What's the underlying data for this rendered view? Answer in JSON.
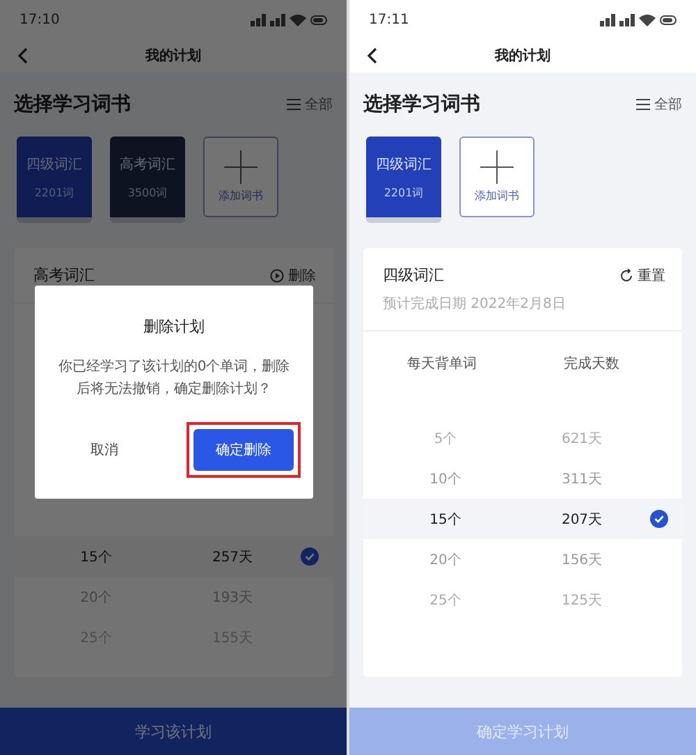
{
  "screens": [
    {
      "status_time": "17:10",
      "title": "我的计划",
      "section_title": "选择学习词书",
      "filter_label": "全部",
      "books": [
        {
          "name": "四级词汇",
          "count": "2201词"
        },
        {
          "name": "高考词汇",
          "count": "3500词"
        }
      ],
      "add_book_label": "添加词书",
      "plan": {
        "name": "高考词汇",
        "action": {
          "kind": "delete",
          "label": "删除"
        },
        "rows": [
          {
            "per_day": "15个",
            "days": "257天",
            "selected": true
          },
          {
            "per_day": "20个",
            "days": "193天",
            "selected": false
          },
          {
            "per_day": "25个",
            "days": "155天",
            "selected": false
          }
        ]
      },
      "bottom_button": {
        "label": "学习该计划",
        "disabled": false
      },
      "dialog": {
        "title": "删除计划",
        "message": "你已经学习了该计划的0个单词，删除后将无法撤销，确定删除计划？",
        "buttons": [
          {
            "label": "取消",
            "kind": "cancel",
            "highlighted": false
          },
          {
            "label": "确定删除",
            "kind": "confirm",
            "highlighted": true
          }
        ]
      }
    },
    {
      "status_time": "17:11",
      "title": "我的计划",
      "section_title": "选择学习词书",
      "filter_label": "全部",
      "books": [
        {
          "name": "四级词汇",
          "count": "2201词"
        }
      ],
      "add_book_label": "添加词书",
      "plan": {
        "name": "四级词汇",
        "action": {
          "kind": "reset",
          "label": "重置"
        },
        "subtitle": "预计完成日期 2022年2月8日",
        "columns": [
          "每天背单词",
          "完成天数"
        ],
        "rows": [
          {
            "per_day": "5个",
            "days": "621天",
            "selected": false
          },
          {
            "per_day": "10个",
            "days": "311天",
            "selected": false
          },
          {
            "per_day": "15个",
            "days": "207天",
            "selected": true
          },
          {
            "per_day": "20个",
            "days": "156天",
            "selected": false
          },
          {
            "per_day": "25个",
            "days": "125天",
            "selected": false
          }
        ]
      },
      "bottom_button": {
        "label": "确定学习计划",
        "disabled": true
      }
    }
  ]
}
